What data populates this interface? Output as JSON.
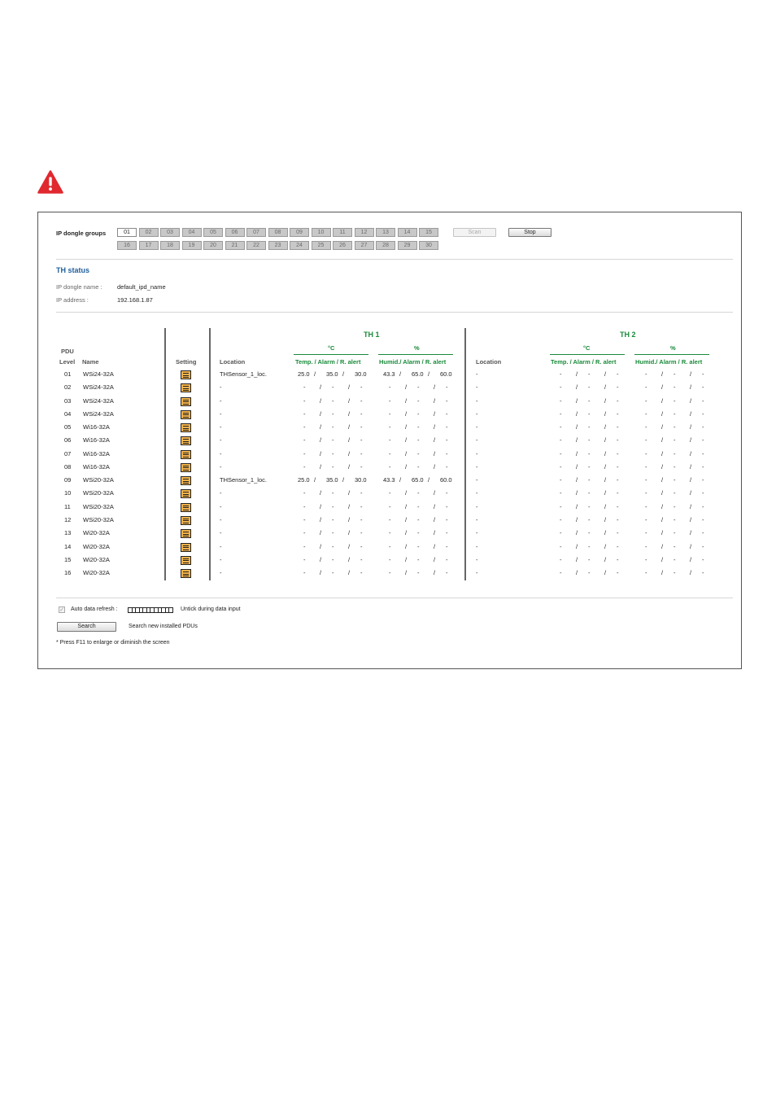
{
  "top_group": {
    "label": "IP dongle groups",
    "groups": [
      "01",
      "02",
      "03",
      "04",
      "05",
      "06",
      "07",
      "08",
      "09",
      "10",
      "11",
      "12",
      "13",
      "14",
      "15",
      "16",
      "17",
      "18",
      "19",
      "20",
      "21",
      "22",
      "23",
      "24",
      "25",
      "26",
      "27",
      "28",
      "29",
      "30"
    ],
    "selected": "01",
    "scan_label": "Scan",
    "stop_label": "Stop"
  },
  "th_status": {
    "title": "TH status",
    "dongle_name_label": "IP dongle name :",
    "dongle_name": "default_ipd_name",
    "ip_label": "IP address :",
    "ip": "192.168.1.87"
  },
  "headers": {
    "pdu": "PDU",
    "level": "Level",
    "name": "Name",
    "setting": "Setting",
    "location": "Location",
    "th1": "TH   1",
    "th2": "TH   2",
    "celsius": "°C",
    "percent": "%",
    "temp_cols": "Temp. / Alarm / R. alert",
    "humid_cols": "Humid./ Alarm / R. alert"
  },
  "rows": [
    {
      "level": "01",
      "name": "WSi24-32A",
      "loc1": "THSensor_1_loc.",
      "t1": [
        "25.0",
        "/",
        "35.0",
        "/",
        "30.0"
      ],
      "h1": [
        "43.3",
        "/",
        "65.0",
        "/",
        "60.0"
      ],
      "loc2": "-",
      "t2": [
        "-",
        "/",
        "-",
        "/",
        "-"
      ],
      "h2": [
        "-",
        "/",
        "-",
        "/",
        "-"
      ]
    },
    {
      "level": "02",
      "name": "WSi24-32A",
      "loc1": "-",
      "t1": [
        "-",
        "/",
        "-",
        "/",
        "-"
      ],
      "h1": [
        "-",
        "/",
        "-",
        "/",
        "-"
      ],
      "loc2": "-",
      "t2": [
        "-",
        "/",
        "-",
        "/",
        "-"
      ],
      "h2": [
        "-",
        "/",
        "-",
        "/",
        "-"
      ]
    },
    {
      "level": "03",
      "name": "WSi24-32A",
      "loc1": "-",
      "t1": [
        "-",
        "/",
        "-",
        "/",
        "-"
      ],
      "h1": [
        "-",
        "/",
        "-",
        "/",
        "-"
      ],
      "loc2": "-",
      "t2": [
        "-",
        "/",
        "-",
        "/",
        "-"
      ],
      "h2": [
        "-",
        "/",
        "-",
        "/",
        "-"
      ]
    },
    {
      "level": "04",
      "name": "WSi24-32A",
      "loc1": "-",
      "t1": [
        "-",
        "/",
        "-",
        "/",
        "-"
      ],
      "h1": [
        "-",
        "/",
        "-",
        "/",
        "-"
      ],
      "loc2": "-",
      "t2": [
        "-",
        "/",
        "-",
        "/",
        "-"
      ],
      "h2": [
        "-",
        "/",
        "-",
        "/",
        "-"
      ]
    },
    {
      "level": "05",
      "name": "Wi16-32A",
      "loc1": "-",
      "t1": [
        "-",
        "/",
        "-",
        "/",
        "-"
      ],
      "h1": [
        "-",
        "/",
        "-",
        "/",
        "-"
      ],
      "loc2": "-",
      "t2": [
        "-",
        "/",
        "-",
        "/",
        "-"
      ],
      "h2": [
        "-",
        "/",
        "-",
        "/",
        "-"
      ]
    },
    {
      "level": "06",
      "name": "Wi16-32A",
      "loc1": "-",
      "t1": [
        "-",
        "/",
        "-",
        "/",
        "-"
      ],
      "h1": [
        "-",
        "/",
        "-",
        "/",
        "-"
      ],
      "loc2": "-",
      "t2": [
        "-",
        "/",
        "-",
        "/",
        "-"
      ],
      "h2": [
        "-",
        "/",
        "-",
        "/",
        "-"
      ]
    },
    {
      "level": "07",
      "name": "Wi16-32A",
      "loc1": "-",
      "t1": [
        "-",
        "/",
        "-",
        "/",
        "-"
      ],
      "h1": [
        "-",
        "/",
        "-",
        "/",
        "-"
      ],
      "loc2": "-",
      "t2": [
        "-",
        "/",
        "-",
        "/",
        "-"
      ],
      "h2": [
        "-",
        "/",
        "-",
        "/",
        "-"
      ]
    },
    {
      "level": "08",
      "name": "Wi16-32A",
      "loc1": "-",
      "t1": [
        "-",
        "/",
        "-",
        "/",
        "-"
      ],
      "h1": [
        "-",
        "/",
        "-",
        "/",
        "-"
      ],
      "loc2": "-",
      "t2": [
        "-",
        "/",
        "-",
        "/",
        "-"
      ],
      "h2": [
        "-",
        "/",
        "-",
        "/",
        "-"
      ]
    },
    {
      "level": "09",
      "name": "WSi20-32A",
      "loc1": "THSensor_1_loc.",
      "t1": [
        "25.0",
        "/",
        "35.0",
        "/",
        "30.0"
      ],
      "h1": [
        "43.3",
        "/",
        "65.0",
        "/",
        "60.0"
      ],
      "loc2": "-",
      "t2": [
        "-",
        "/",
        "-",
        "/",
        "-"
      ],
      "h2": [
        "-",
        "/",
        "-",
        "/",
        "-"
      ]
    },
    {
      "level": "10",
      "name": "WSi20-32A",
      "loc1": "-",
      "t1": [
        "-",
        "/",
        "-",
        "/",
        "-"
      ],
      "h1": [
        "-",
        "/",
        "-",
        "/",
        "-"
      ],
      "loc2": "-",
      "t2": [
        "-",
        "/",
        "-",
        "/",
        "-"
      ],
      "h2": [
        "-",
        "/",
        "-",
        "/",
        "-"
      ]
    },
    {
      "level": "11",
      "name": "WSi20-32A",
      "loc1": "-",
      "t1": [
        "-",
        "/",
        "-",
        "/",
        "-"
      ],
      "h1": [
        "-",
        "/",
        "-",
        "/",
        "-"
      ],
      "loc2": "-",
      "t2": [
        "-",
        "/",
        "-",
        "/",
        "-"
      ],
      "h2": [
        "-",
        "/",
        "-",
        "/",
        "-"
      ]
    },
    {
      "level": "12",
      "name": "WSi20-32A",
      "loc1": "-",
      "t1": [
        "-",
        "/",
        "-",
        "/",
        "-"
      ],
      "h1": [
        "-",
        "/",
        "-",
        "/",
        "-"
      ],
      "loc2": "-",
      "t2": [
        "-",
        "/",
        "-",
        "/",
        "-"
      ],
      "h2": [
        "-",
        "/",
        "-",
        "/",
        "-"
      ]
    },
    {
      "level": "13",
      "name": "Wi20-32A",
      "loc1": "-",
      "t1": [
        "-",
        "/",
        "-",
        "/",
        "-"
      ],
      "h1": [
        "-",
        "/",
        "-",
        "/",
        "-"
      ],
      "loc2": "-",
      "t2": [
        "-",
        "/",
        "-",
        "/",
        "-"
      ],
      "h2": [
        "-",
        "/",
        "-",
        "/",
        "-"
      ]
    },
    {
      "level": "14",
      "name": "Wi20-32A",
      "loc1": "-",
      "t1": [
        "-",
        "/",
        "-",
        "/",
        "-"
      ],
      "h1": [
        "-",
        "/",
        "-",
        "/",
        "-"
      ],
      "loc2": "-",
      "t2": [
        "-",
        "/",
        "-",
        "/",
        "-"
      ],
      "h2": [
        "-",
        "/",
        "-",
        "/",
        "-"
      ]
    },
    {
      "level": "15",
      "name": "Wi20-32A",
      "loc1": "-",
      "t1": [
        "-",
        "/",
        "-",
        "/",
        "-"
      ],
      "h1": [
        "-",
        "/",
        "-",
        "/",
        "-"
      ],
      "loc2": "-",
      "t2": [
        "-",
        "/",
        "-",
        "/",
        "-"
      ],
      "h2": [
        "-",
        "/",
        "-",
        "/",
        "-"
      ]
    },
    {
      "level": "16",
      "name": "Wi20-32A",
      "loc1": "-",
      "t1": [
        "-",
        "/",
        "-",
        "/",
        "-"
      ],
      "h1": [
        "-",
        "/",
        "-",
        "/",
        "-"
      ],
      "loc2": "-",
      "t2": [
        "-",
        "/",
        "-",
        "/",
        "-"
      ],
      "h2": [
        "-",
        "/",
        "-",
        "/",
        "-"
      ]
    }
  ],
  "footer": {
    "auto_refresh_label": "Auto data refresh :",
    "auto_refresh_checked": true,
    "untick_note": "Untick during data input",
    "search_label": "Search",
    "search_note": "Search new installed PDUs",
    "f11_note": "* Press F11 to enlarge or diminish the screen"
  },
  "icons": {
    "warning": "warning-icon",
    "setting": "setting-icon"
  },
  "colors": {
    "accent_blue": "#1f5f9a",
    "green_header": "#1a8a3a",
    "warning_red": "#e0282e",
    "setting_orange": "#f1b24a"
  }
}
